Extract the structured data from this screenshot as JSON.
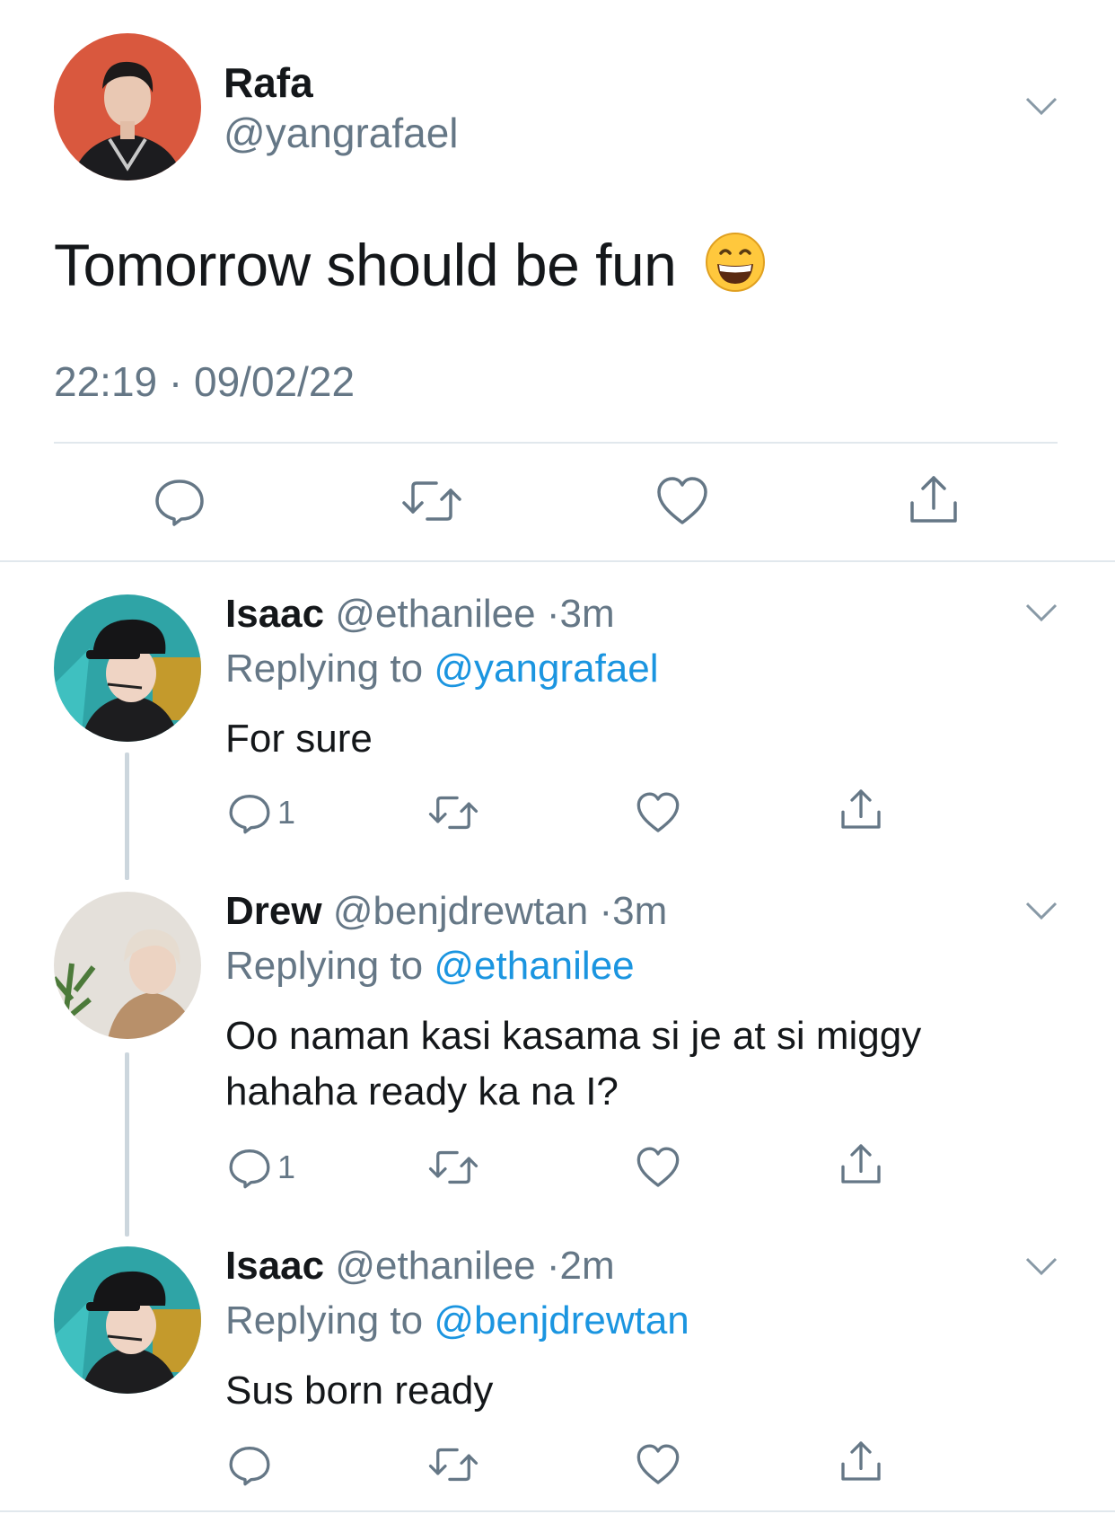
{
  "main_tweet": {
    "name": "Rafa",
    "handle": "@yangrafael",
    "text": "Tomorrow should be fun",
    "emoji": "😄",
    "timestamp": "22:19 · 09/02/22",
    "avatar_icon": "avatar-photo"
  },
  "replies": [
    {
      "name": "Isaac",
      "handle": "@ethanilee",
      "sep": "·",
      "time": "3m",
      "replying_prefix": "Replying to",
      "replying_to": "@yangrafael",
      "text": "For sure",
      "reply_count": "1"
    },
    {
      "name": "Drew",
      "handle": "@benjdrewtan",
      "sep": "·",
      "time": "3m",
      "replying_prefix": "Replying to",
      "replying_to": "@ethanilee",
      "text": "Oo naman kasi kasama si je at si miggy hahaha ready ka na I?",
      "reply_count": "1"
    },
    {
      "name": "Isaac",
      "handle": "@ethanilee",
      "sep": "·",
      "time": "2m",
      "replying_prefix": "Replying to",
      "replying_to": "@benjdrewtan",
      "text": "Sus born ready",
      "reply_count": ""
    }
  ],
  "colors": {
    "link": "#1b95e0",
    "muted": "#657786",
    "divider": "#e1e8ed",
    "thread_line": "#ccd6dd"
  }
}
